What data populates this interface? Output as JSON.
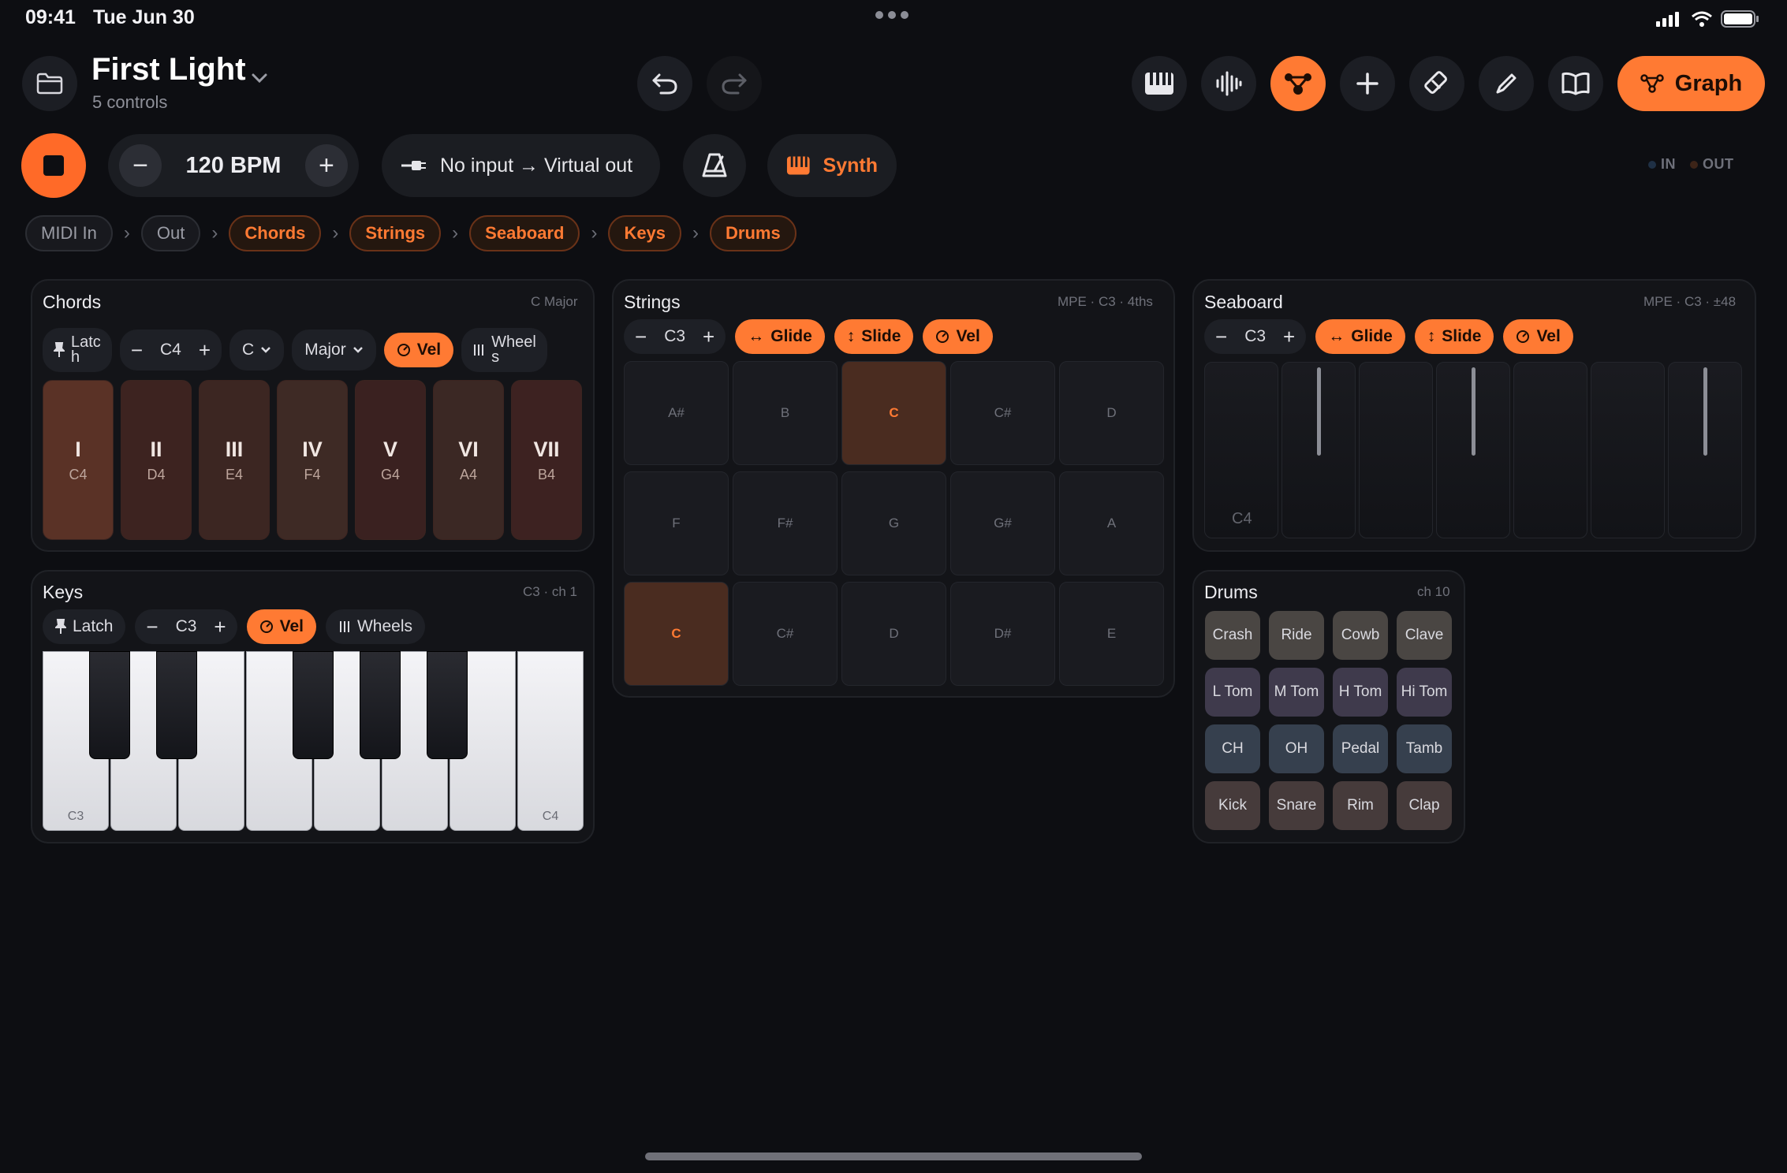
{
  "status": {
    "time": "09:41",
    "date": "Tue Jun 30"
  },
  "header": {
    "title": "First Light",
    "subtitle": "5 controls",
    "graph_label": "Graph"
  },
  "transport": {
    "bpm": "120 BPM",
    "route": "No input → Virtual out",
    "instrument": "Synth",
    "in_label": "IN",
    "out_label": "OUT"
  },
  "breadcrumb": [
    "MIDI In",
    "Out",
    "Chords",
    "Strings",
    "Seaboard",
    "Keys",
    "Drums"
  ],
  "chords": {
    "title": "Chords",
    "meta": "C Major",
    "latch": "Latc\nh",
    "octave": "C4",
    "key": "C",
    "scale": "Major",
    "vel": "Vel",
    "wheels": "Wheel\ns",
    "pads": [
      {
        "rn": "I",
        "note": "C4"
      },
      {
        "rn": "II",
        "note": "D4"
      },
      {
        "rn": "III",
        "note": "E4"
      },
      {
        "rn": "IV",
        "note": "F4"
      },
      {
        "rn": "V",
        "note": "G4"
      },
      {
        "rn": "VI",
        "note": "A4"
      },
      {
        "rn": "VII",
        "note": "B4"
      }
    ]
  },
  "strings": {
    "title": "Strings",
    "meta": "MPE · C3 · 4ths",
    "octave": "C3",
    "glide": "Glide",
    "slide": "Slide",
    "vel": "Vel",
    "rows": [
      [
        "A#",
        "B",
        "C",
        "C#",
        "D"
      ],
      [
        "F",
        "F#",
        "G",
        "G#",
        "A"
      ],
      [
        "C",
        "C#",
        "D",
        "D#",
        "E"
      ]
    ]
  },
  "seaboard": {
    "title": "Seaboard",
    "meta": "MPE · C3 · ±48",
    "octave": "C3",
    "glide": "Glide",
    "slide": "Slide",
    "vel": "Vel",
    "key_label": "C4"
  },
  "keys": {
    "title": "Keys",
    "meta": "C3 · ch 1",
    "latch": "Latch",
    "octave": "C3",
    "vel": "Vel",
    "wheels": "Wheels",
    "low_label": "C3",
    "high_label": "C4"
  },
  "drums": {
    "title": "Drums",
    "meta": "ch 10",
    "pads": [
      [
        "Crash",
        "Ride",
        "Cowb",
        "Clave"
      ],
      [
        "L Tom",
        "M Tom",
        "H Tom",
        "Hi Tom"
      ],
      [
        "CH",
        "OH",
        "Pedal",
        "Tamb"
      ],
      [
        "Kick",
        "Snare",
        "Rim",
        "Clap"
      ]
    ]
  },
  "colors": {
    "accent": "#ff7a33",
    "background": "#0d0e12"
  }
}
